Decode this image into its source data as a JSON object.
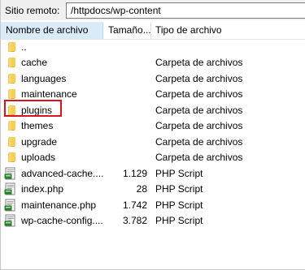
{
  "address": {
    "label": "Sitio remoto:",
    "value": "/httpdocs/wp-content"
  },
  "columns": {
    "name": "Nombre de archivo",
    "size": "Tamaño...",
    "type": "Tipo de archivo"
  },
  "rows": [
    {
      "name": "..",
      "size": "",
      "type": "",
      "icon": "folder-icon"
    },
    {
      "name": "cache",
      "size": "",
      "type": "Carpeta de archivos",
      "icon": "folder-icon"
    },
    {
      "name": "languages",
      "size": "",
      "type": "Carpeta de archivos",
      "icon": "folder-icon"
    },
    {
      "name": "maintenance",
      "size": "",
      "type": "Carpeta de archivos",
      "icon": "folder-icon"
    },
    {
      "name": "plugins",
      "size": "",
      "type": "Carpeta de archivos",
      "icon": "folder-icon"
    },
    {
      "name": "themes",
      "size": "",
      "type": "Carpeta de archivos",
      "icon": "folder-icon"
    },
    {
      "name": "upgrade",
      "size": "",
      "type": "Carpeta de archivos",
      "icon": "folder-icon"
    },
    {
      "name": "uploads",
      "size": "",
      "type": "Carpeta de archivos",
      "icon": "folder-icon"
    },
    {
      "name": "advanced-cache....",
      "size": "1.129",
      "type": "PHP Script",
      "icon": "php-script-icon"
    },
    {
      "name": "index.php",
      "size": "28",
      "type": "PHP Script",
      "icon": "php-script-icon"
    },
    {
      "name": "maintenance.php",
      "size": "1.742",
      "type": "PHP Script",
      "icon": "php-script-icon"
    },
    {
      "name": "wp-cache-config....",
      "size": "3.782",
      "type": "PHP Script",
      "icon": "php-script-icon"
    }
  ],
  "colors": {
    "header_sort_bg": "#d9ebf9",
    "highlight_border": "#d9141e",
    "folder": "#f4c84a"
  }
}
